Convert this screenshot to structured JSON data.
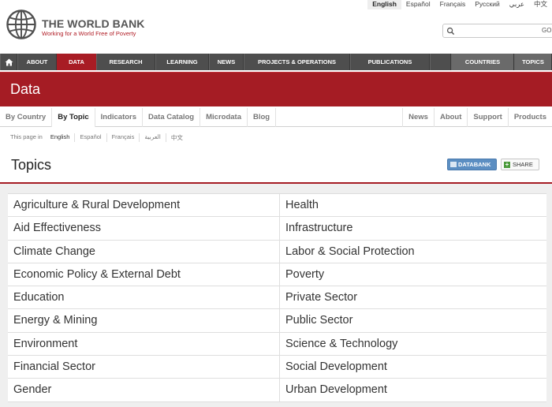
{
  "languages": [
    "English",
    "Español",
    "Français",
    "Русский",
    "عربي",
    "中文"
  ],
  "header": {
    "title": "THE WORLD BANK",
    "tagline": "Working for a World Free of Poverty",
    "search_button": "GO"
  },
  "main_nav": {
    "items": [
      "ABOUT",
      "DATA",
      "RESEARCH",
      "LEARNING",
      "NEWS",
      "PROJECTS & OPERATIONS",
      "PUBLICATIONS",
      "COUNTRIES",
      "TOPICS"
    ],
    "active": "DATA"
  },
  "banner": {
    "title": "Data"
  },
  "sub_tabs": {
    "left": [
      "By Country",
      "By Topic",
      "Indicators",
      "Data Catalog",
      "Microdata",
      "Blog"
    ],
    "right": [
      "News",
      "About",
      "Support",
      "Products"
    ],
    "active": "By Topic"
  },
  "page_language": {
    "prefix": "This page in",
    "options": [
      "English",
      "Español",
      "Français",
      "العربية",
      "中文"
    ],
    "active": "English"
  },
  "topics": {
    "title": "Topics",
    "databank_button": "DATABANK",
    "share_button": "SHARE",
    "left_column": [
      "Agriculture & Rural Development",
      "Aid Effectiveness",
      "Climate Change",
      "Economic Policy & External Debt",
      "Education",
      "Energy & Mining",
      "Environment",
      "Financial Sector",
      "Gender"
    ],
    "right_column": [
      "Health",
      "Infrastructure",
      "Labor & Social Protection",
      "Poverty",
      "Private Sector",
      "Public Sector",
      "Science & Technology",
      "Social Development",
      "Urban Development"
    ]
  },
  "colors": {
    "brand_red": "#a51c24",
    "nav_dark": "#4e4e4e",
    "databank_blue": "#5b8ec2"
  }
}
